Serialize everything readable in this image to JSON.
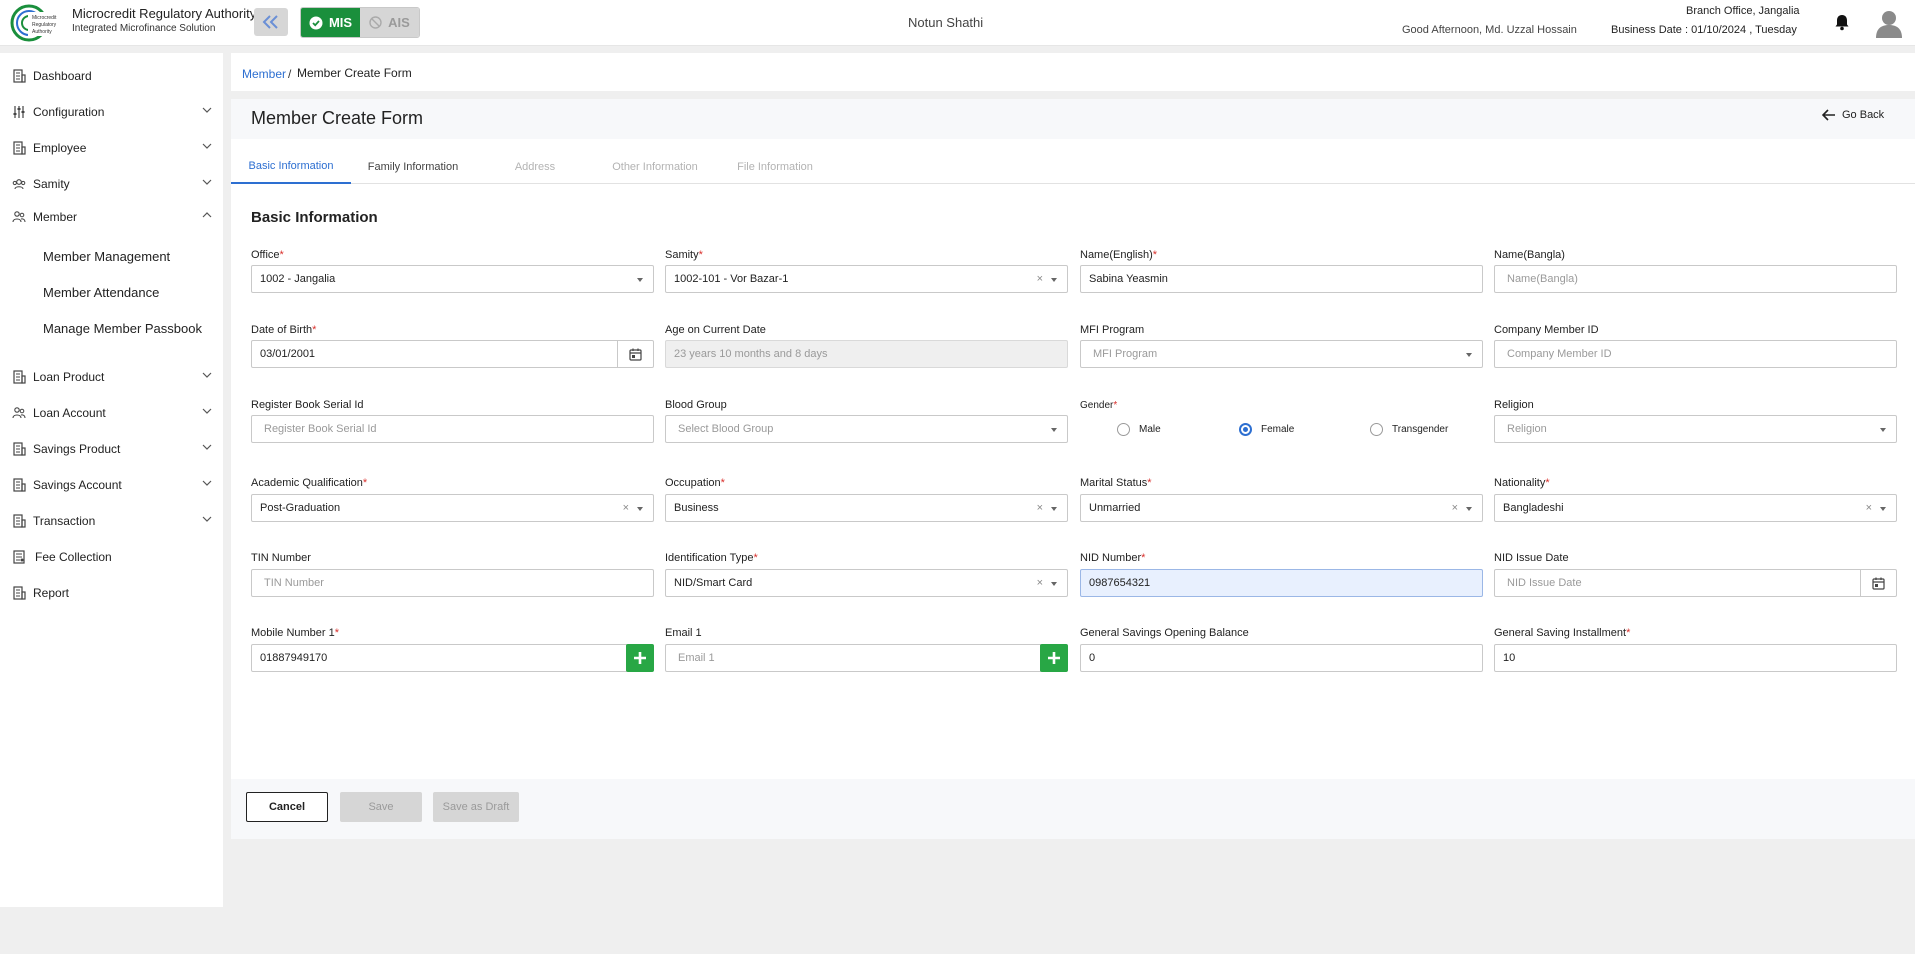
{
  "header": {
    "brand_title": "Microcredit Regulatory Authority",
    "brand_subtitle": "Integrated Microfinance Solution",
    "logo_text": "Microcredit Regulatory Authority",
    "mis_label": "MIS",
    "ais_label": "AIS",
    "app_name": "Notun Shathi",
    "greeting": "Good Afternoon, Md. Uzzal Hossain",
    "branch": "Branch Office, Jangalia",
    "business_date": "Business Date : 01/10/2024 , Tuesday"
  },
  "sidebar": {
    "items": [
      {
        "label": "Dashboard",
        "icon": "building-icon"
      },
      {
        "label": "Configuration",
        "icon": "sliders-icon"
      },
      {
        "label": "Employee",
        "icon": "building-icon"
      },
      {
        "label": "Samity",
        "icon": "group-icon"
      },
      {
        "label": "Member",
        "icon": "users-icon"
      },
      {
        "label": "Loan Product",
        "icon": "building-icon"
      },
      {
        "label": "Loan Account",
        "icon": "users-icon"
      },
      {
        "label": "Savings Product",
        "icon": "building-icon"
      },
      {
        "label": "Savings Account",
        "icon": "building-icon"
      },
      {
        "label": "Transaction",
        "icon": "building-icon"
      },
      {
        "label": "Fee Collection",
        "icon": "receipt-icon"
      },
      {
        "label": "Report",
        "icon": "building-icon"
      }
    ],
    "member_sub": [
      "Member Management",
      "Member Attendance",
      "Manage Member Passbook"
    ]
  },
  "breadcrumb": {
    "parent": "Member",
    "separator": "/",
    "current": "Member Create Form"
  },
  "page": {
    "title": "Member Create Form",
    "go_back": "Go Back",
    "section_title": "Basic Information"
  },
  "tabs": [
    {
      "label": "Basic Information",
      "state": "active"
    },
    {
      "label": "Family Information",
      "state": "normal"
    },
    {
      "label": "Address",
      "state": "disabled"
    },
    {
      "label": "Other Information",
      "state": "disabled"
    },
    {
      "label": "File Information",
      "state": "disabled"
    }
  ],
  "form": {
    "office": {
      "label": "Office",
      "value": "1002 - Jangalia"
    },
    "samity": {
      "label": "Samity",
      "value": "1002-101 - Vor Bazar-1"
    },
    "name_en": {
      "label": "Name(English)",
      "value": "Sabina Yeasmin"
    },
    "name_bn": {
      "label": "Name(Bangla)",
      "placeholder": "Name(Bangla)"
    },
    "dob": {
      "label": "Date of Birth",
      "value": "03/01/2001"
    },
    "age": {
      "label": "Age on Current Date",
      "value": "23 years 10 months and 8 days"
    },
    "mfi": {
      "label": "MFI Program",
      "placeholder": "MFI Program"
    },
    "company_id": {
      "label": "Company Member ID",
      "placeholder": "Company Member ID"
    },
    "register_serial": {
      "label": "Register Book Serial Id",
      "placeholder": "Register Book Serial Id"
    },
    "blood_group": {
      "label": "Blood Group",
      "placeholder": "Select Blood Group"
    },
    "gender": {
      "label": "Gender",
      "options": [
        "Male",
        "Female",
        "Transgender"
      ],
      "selected": "Female"
    },
    "religion": {
      "label": "Religion",
      "placeholder": "Religion"
    },
    "academic": {
      "label": "Academic Qualification",
      "value": "Post-Graduation"
    },
    "occupation": {
      "label": "Occupation",
      "value": "Business"
    },
    "marital": {
      "label": "Marital Status",
      "value": "Unmarried"
    },
    "nationality": {
      "label": "Nationality",
      "value": "Bangladeshi"
    },
    "tin": {
      "label": "TIN Number",
      "placeholder": "TIN Number"
    },
    "id_type": {
      "label": "Identification Type",
      "value": "NID/Smart Card"
    },
    "nid": {
      "label": "NID Number",
      "value": "0987654321"
    },
    "nid_issue": {
      "label": "NID Issue Date",
      "placeholder": "NID Issue Date"
    },
    "mobile": {
      "label": "Mobile Number 1",
      "value": "01887949170"
    },
    "email": {
      "label": "Email 1",
      "placeholder": "Email 1"
    },
    "gen_savings_opening": {
      "label": "General Savings Opening Balance",
      "value": "0"
    },
    "gen_saving_installment": {
      "label": "General Saving Installment",
      "value": "10"
    },
    "required_mark": "*",
    "clear_mark": "×"
  },
  "buttons": {
    "cancel": "Cancel",
    "save": "Save",
    "save_draft": "Save as Draft"
  },
  "colors": {
    "brand_green": "#1a8f3c",
    "link_blue": "#2d6fd1",
    "required_red": "#d9302c",
    "add_green": "#28a745"
  }
}
